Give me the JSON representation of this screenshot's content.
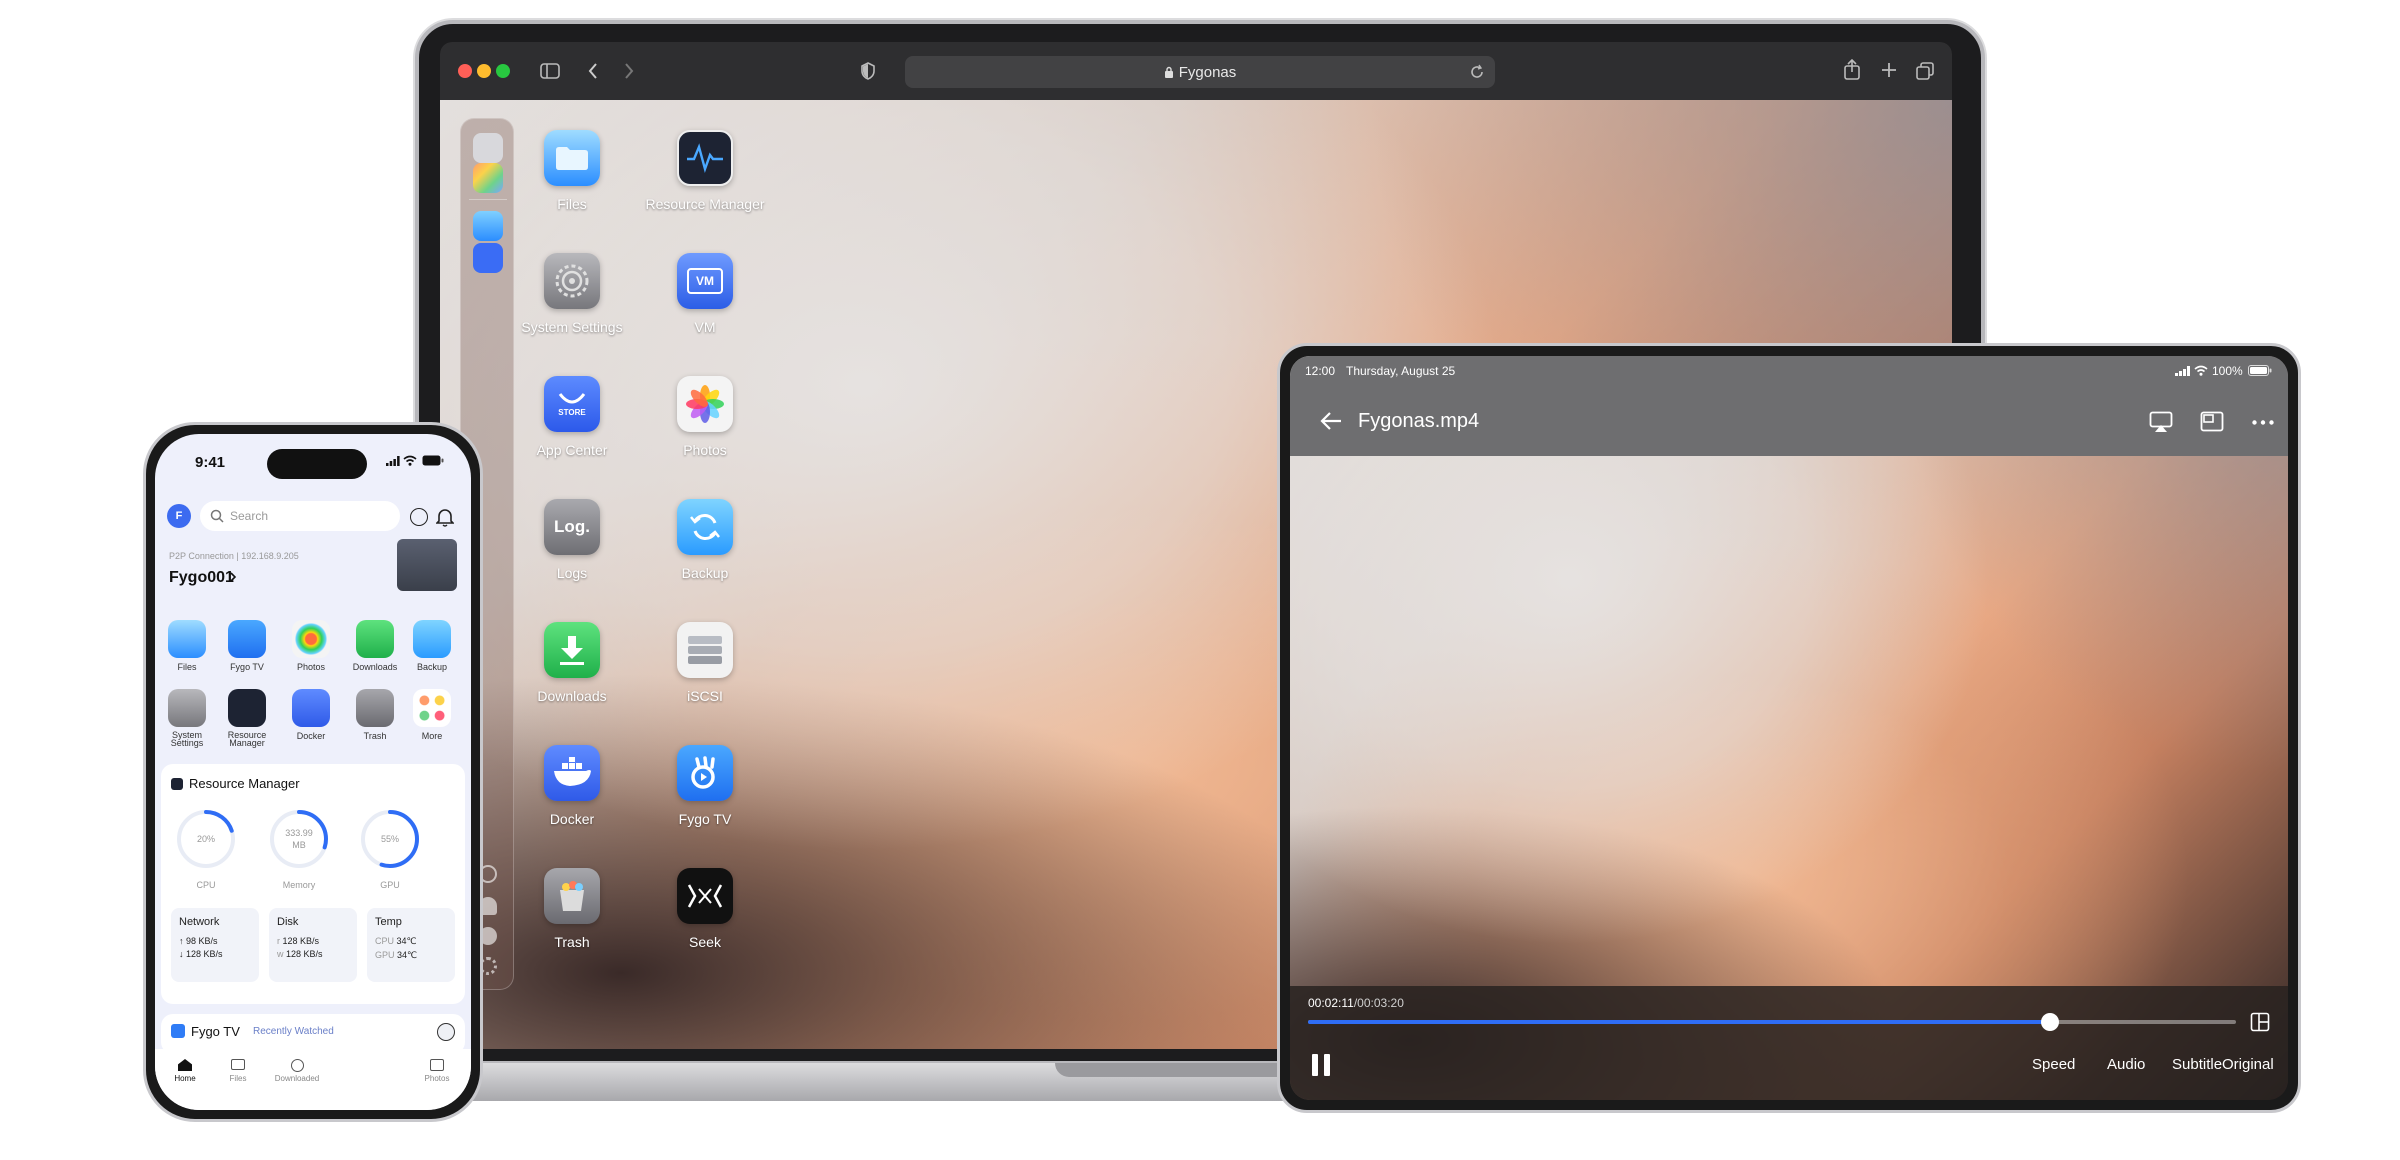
{
  "laptop": {
    "browser": {
      "url_text": "Fygonas"
    },
    "apps": [
      {
        "label": "Files",
        "icon": "folder-icon"
      },
      {
        "label": "Resource Manager",
        "icon": "pulse-icon"
      },
      {
        "label": "System Settings",
        "icon": "gear-icon"
      },
      {
        "label": "VM",
        "icon": "vm-icon"
      },
      {
        "label": "App Center",
        "icon": "store-icon"
      },
      {
        "label": "Photos",
        "icon": "flower-icon"
      },
      {
        "label": "Logs",
        "icon": "log-icon"
      },
      {
        "label": "Backup",
        "icon": "sync-icon"
      },
      {
        "label": "Downloads",
        "icon": "download-icon"
      },
      {
        "label": "iSCSI",
        "icon": "server-icon"
      },
      {
        "label": "Docker",
        "icon": "whale-icon"
      },
      {
        "label": "Fygo TV",
        "icon": "tv-icon"
      },
      {
        "label": "Trash",
        "icon": "trash-icon"
      },
      {
        "label": "Seek",
        "icon": "seek-icon"
      }
    ],
    "icon_texts": {
      "vm": "VM",
      "store": "STORE",
      "logs": "Log."
    }
  },
  "tablet": {
    "status": {
      "time": "12:00",
      "date": "Thursday, August 25",
      "battery": "100%"
    },
    "player": {
      "title": "Fygonas.mp4",
      "elapsed": "00:02:11",
      "total": "/00:03:20",
      "progress": 0.8,
      "controls": [
        "Speed",
        "Audio",
        "Subtitle",
        "Original"
      ]
    }
  },
  "phone": {
    "time": "9:41",
    "avatar": "F",
    "search_placeholder": "Search",
    "connection": "P2P Connection | 192.168.9.205",
    "device": "Fygo001",
    "apps": [
      {
        "label": "Files"
      },
      {
        "label": "Fygo TV"
      },
      {
        "label": "Photos"
      },
      {
        "label": "Downloads"
      },
      {
        "label": "Backup"
      },
      {
        "label": "System Settings"
      },
      {
        "label": "Resource Manager"
      },
      {
        "label": "Docker"
      },
      {
        "label": "Trash"
      },
      {
        "label": "More"
      }
    ],
    "resource": {
      "title": "Resource Manager",
      "gauges": [
        {
          "value": "20%",
          "label": "CPU",
          "frac": 0.2
        },
        {
          "value": "333.99",
          "value2": "MB",
          "label": "Memory",
          "frac": 0.3
        },
        {
          "value": "55%",
          "label": "GPU",
          "frac": 0.55
        }
      ],
      "network": {
        "title": "Network",
        "up": "98 KB/s",
        "down": "128 KB/s"
      },
      "disk": {
        "title": "Disk",
        "r_label": "r",
        "r": "128 KB/s",
        "w_label": "w",
        "w": "128 KB/s"
      },
      "temp": {
        "title": "Temp",
        "cpu_label": "CPU",
        "cpu": "34℃",
        "gpu_label": "GPU",
        "gpu": "34℃"
      }
    },
    "tv": {
      "title": "Fygo TV",
      "subtitle": "Recently Watched"
    },
    "tabbar": [
      "Home",
      "Files",
      "Downloaded",
      "Photos"
    ]
  }
}
